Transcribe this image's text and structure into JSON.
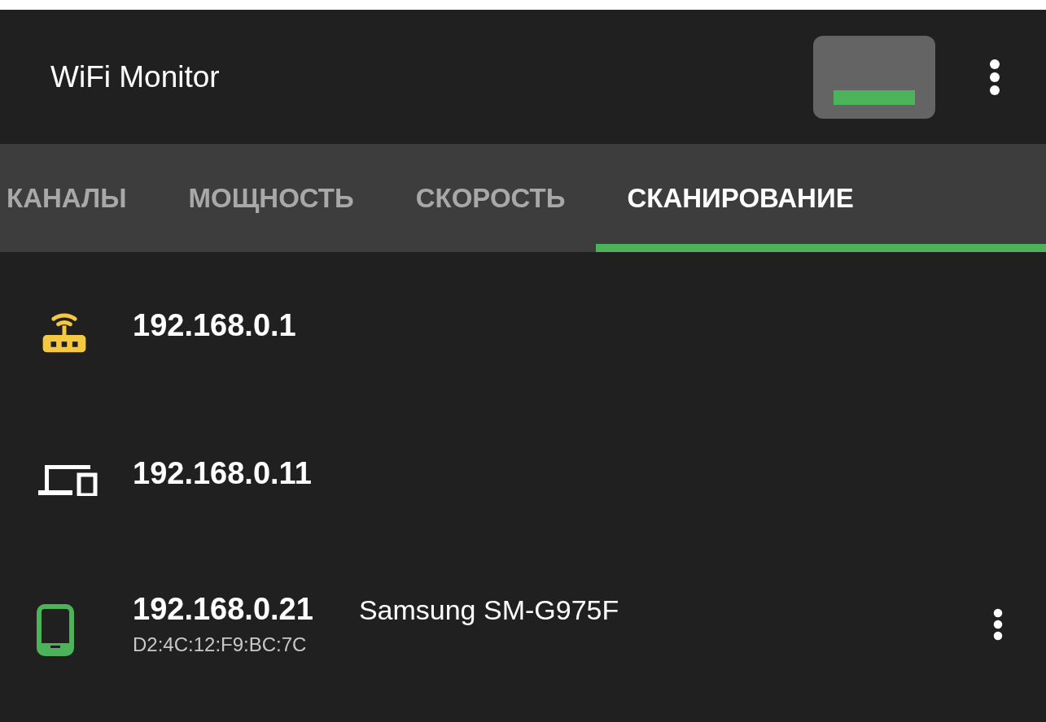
{
  "app_bar": {
    "title": "WiFi Monitor"
  },
  "tabs": [
    {
      "label": "КАНАЛЫ",
      "selected": false
    },
    {
      "label": "МОЩНОСТЬ",
      "selected": false
    },
    {
      "label": "СКОРОСТЬ",
      "selected": false
    },
    {
      "label": "СКАНИРОВАНИЕ",
      "selected": true
    }
  ],
  "devices": [
    {
      "kind": "router",
      "color": "#f5c842",
      "ip": "192.168.0.1"
    },
    {
      "kind": "computer",
      "color": "#ffffff",
      "ip": "192.168.0.11"
    },
    {
      "kind": "phone",
      "color": "#4cb35a",
      "ip": "192.168.0.21",
      "name": "Samsung SM-G975F",
      "mac": "D2:4C:12:F9:BC:7C",
      "has_menu": true
    }
  ]
}
